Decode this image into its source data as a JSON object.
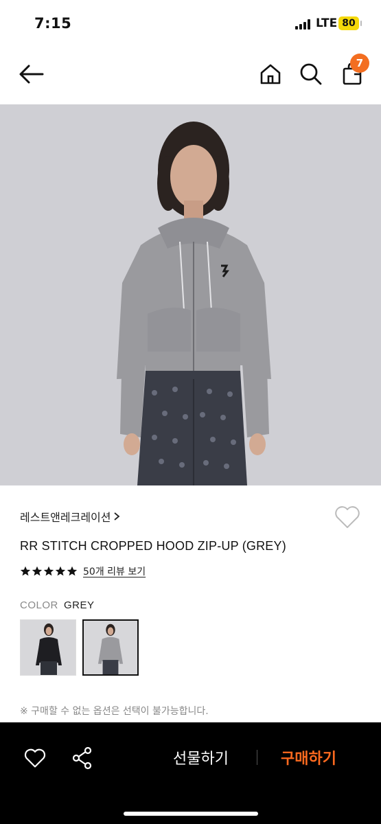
{
  "status_bar": {
    "time": "7:15",
    "network": "LTE",
    "battery": "80"
  },
  "nav": {
    "cart_count": "7"
  },
  "product": {
    "brand": "레스트앤레크레이션",
    "title": "RR STITCH CROPPED HOOD ZIP-UP (GREY)",
    "rating_stars": 5,
    "review_link": "50개 리뷰 보기",
    "color_label": "COLOR",
    "color_value": "GREY",
    "color_options": [
      "black",
      "grey"
    ],
    "selected_color_index": 1,
    "notice": "※ 구매할 수 없는 옵션은 선택이 불가능합니다."
  },
  "bottom_bar": {
    "gift_label": "선물하기",
    "buy_label": "구매하기"
  },
  "colors": {
    "accent": "#f36e21",
    "buy_text": "#ff6a1f",
    "battery": "#f5d90a"
  }
}
